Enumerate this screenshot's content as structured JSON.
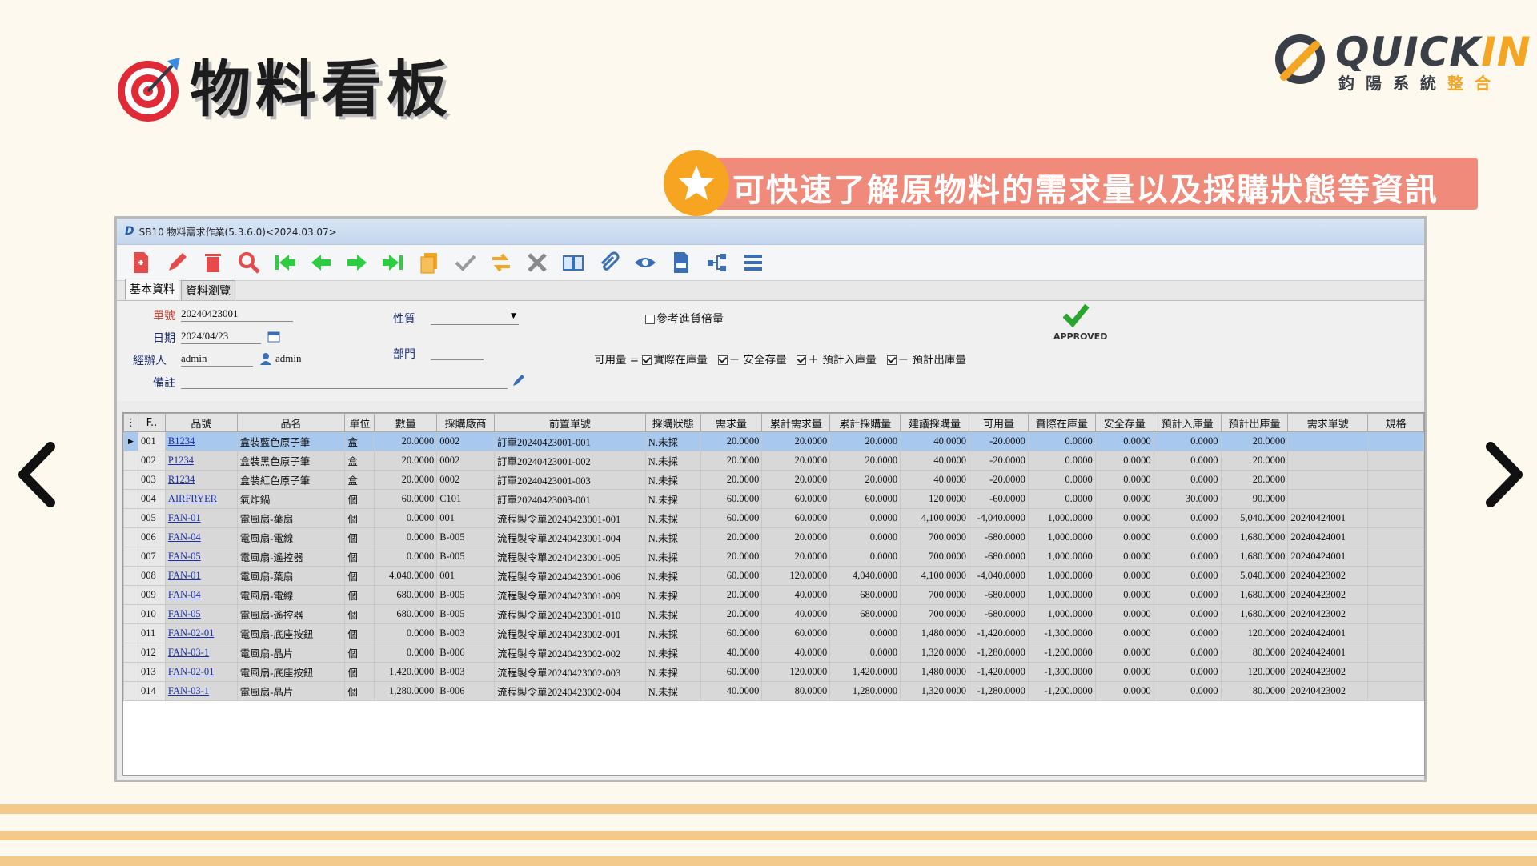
{
  "page": {
    "title": "物料看板",
    "banner": "可快速了解原物料的需求量以及採購狀態等資訊"
  },
  "logo": {
    "name_main": "QUICK",
    "name_accent": "IN",
    "sub_main": "鈞陽系統",
    "sub_accent": "整合"
  },
  "colors": {
    "banner": "#f08a7a",
    "accent": "#f5a524",
    "stripe": "#f3c98c",
    "selected_row": "#a9c8ee"
  },
  "window": {
    "title": "SB10 物料需求作業(5.3.6.0)<2024.03.07>"
  },
  "toolbar": {
    "icons": [
      "new-doc-icon",
      "edit-pencil-icon",
      "delete-trash-icon",
      "search-icon",
      "first-record-icon",
      "prev-record-icon",
      "next-record-icon",
      "last-record-icon",
      "copy-icon",
      "confirm-check-icon",
      "transfer-icon",
      "cancel-x-icon",
      "book-icon",
      "attach-icon",
      "view-eye-icon",
      "print-icon",
      "tree-icon",
      "menu-icon"
    ]
  },
  "tabs": [
    "基本資料",
    "資料瀏覽"
  ],
  "form": {
    "order_no_label": "單號",
    "order_no": "20240423001",
    "date_label": "日期",
    "date": "2024/04/23",
    "handler_label": "經辦人",
    "handler": "admin",
    "handler_name": "admin",
    "note_label": "備註",
    "note": "",
    "nature_label": "性質",
    "nature": "",
    "dept_label": "部門",
    "dept": "",
    "ref_label": "參考進貨倍量",
    "formula_label": "可用量 =",
    "formula_item1": "實際在庫量",
    "formula_item2": "－ 安全存量",
    "formula_item3": "＋ 預計入庫量",
    "formula_item4": "－ 預計出庫量",
    "status": "APPROVED"
  },
  "grid": {
    "columns": [
      "F..",
      "品號",
      "品名",
      "單位",
      "數量",
      "採購廠商",
      "前置單號",
      "採購狀態",
      "需求量",
      "累計需求量",
      "累計採購量",
      "建議採購量",
      "可用量",
      "實際在庫量",
      "安全存量",
      "預計入庫量",
      "預計出庫量",
      "需求單號",
      "規格"
    ],
    "rows": [
      [
        "001",
        "B1234",
        "盒裝藍色原子筆",
        "盒",
        "20.0000",
        "0002",
        "訂單20240423001-001",
        "N.未採",
        "20.0000",
        "20.0000",
        "20.0000",
        "40.0000",
        "-20.0000",
        "0.0000",
        "0.0000",
        "0.0000",
        "20.0000",
        "",
        ""
      ],
      [
        "002",
        "P1234",
        "盒裝黑色原子筆",
        "盒",
        "20.0000",
        "0002",
        "訂單20240423001-002",
        "N.未採",
        "20.0000",
        "20.0000",
        "20.0000",
        "40.0000",
        "-20.0000",
        "0.0000",
        "0.0000",
        "0.0000",
        "20.0000",
        "",
        ""
      ],
      [
        "003",
        "R1234",
        "盒裝紅色原子筆",
        "盒",
        "20.0000",
        "0002",
        "訂單20240423001-003",
        "N.未採",
        "20.0000",
        "20.0000",
        "20.0000",
        "40.0000",
        "-20.0000",
        "0.0000",
        "0.0000",
        "0.0000",
        "20.0000",
        "",
        ""
      ],
      [
        "004",
        "AIRFRYER",
        "氣炸鍋",
        "個",
        "60.0000",
        "C101",
        "訂單20240423003-001",
        "N.未採",
        "60.0000",
        "60.0000",
        "60.0000",
        "120.0000",
        "-60.0000",
        "0.0000",
        "0.0000",
        "30.0000",
        "90.0000",
        "",
        ""
      ],
      [
        "005",
        "FAN-01",
        "電風扇-葉扇",
        "個",
        "0.0000",
        "001",
        "流程製令單20240423001-001",
        "N.未採",
        "60.0000",
        "60.0000",
        "0.0000",
        "4,100.0000",
        "-4,040.0000",
        "1,000.0000",
        "0.0000",
        "0.0000",
        "5,040.0000",
        "20240424001",
        ""
      ],
      [
        "006",
        "FAN-04",
        "電風扇-電線",
        "個",
        "0.0000",
        "B-005",
        "流程製令單20240423001-004",
        "N.未採",
        "20.0000",
        "20.0000",
        "0.0000",
        "700.0000",
        "-680.0000",
        "1,000.0000",
        "0.0000",
        "0.0000",
        "1,680.0000",
        "20240424001",
        ""
      ],
      [
        "007",
        "FAN-05",
        "電風扇-遙控器",
        "個",
        "0.0000",
        "B-005",
        "流程製令單20240423001-005",
        "N.未採",
        "20.0000",
        "20.0000",
        "0.0000",
        "700.0000",
        "-680.0000",
        "1,000.0000",
        "0.0000",
        "0.0000",
        "1,680.0000",
        "20240424001",
        ""
      ],
      [
        "008",
        "FAN-01",
        "電風扇-葉扇",
        "個",
        "4,040.0000",
        "001",
        "流程製令單20240423001-006",
        "N.未採",
        "60.0000",
        "120.0000",
        "4,040.0000",
        "4,100.0000",
        "-4,040.0000",
        "1,000.0000",
        "0.0000",
        "0.0000",
        "5,040.0000",
        "20240423002",
        ""
      ],
      [
        "009",
        "FAN-04",
        "電風扇-電線",
        "個",
        "680.0000",
        "B-005",
        "流程製令單20240423001-009",
        "N.未採",
        "20.0000",
        "40.0000",
        "680.0000",
        "700.0000",
        "-680.0000",
        "1,000.0000",
        "0.0000",
        "0.0000",
        "1,680.0000",
        "20240423002",
        ""
      ],
      [
        "010",
        "FAN-05",
        "電風扇-遙控器",
        "個",
        "680.0000",
        "B-005",
        "流程製令單20240423001-010",
        "N.未採",
        "20.0000",
        "40.0000",
        "680.0000",
        "700.0000",
        "-680.0000",
        "1,000.0000",
        "0.0000",
        "0.0000",
        "1,680.0000",
        "20240423002",
        ""
      ],
      [
        "011",
        "FAN-02-01",
        "電風扇-底座按鈕",
        "個",
        "0.0000",
        "B-003",
        "流程製令單20240423002-001",
        "N.未採",
        "60.0000",
        "60.0000",
        "0.0000",
        "1,480.0000",
        "-1,420.0000",
        "-1,300.0000",
        "0.0000",
        "0.0000",
        "120.0000",
        "20240424001",
        ""
      ],
      [
        "012",
        "FAN-03-1",
        "電風扇-晶片",
        "個",
        "0.0000",
        "B-006",
        "流程製令單20240423002-002",
        "N.未採",
        "40.0000",
        "40.0000",
        "0.0000",
        "1,320.0000",
        "-1,280.0000",
        "-1,200.0000",
        "0.0000",
        "0.0000",
        "80.0000",
        "20240424001",
        ""
      ],
      [
        "013",
        "FAN-02-01",
        "電風扇-底座按鈕",
        "個",
        "1,420.0000",
        "B-003",
        "流程製令單20240423002-003",
        "N.未採",
        "60.0000",
        "120.0000",
        "1,420.0000",
        "1,480.0000",
        "-1,420.0000",
        "-1,300.0000",
        "0.0000",
        "0.0000",
        "120.0000",
        "20240423002",
        ""
      ],
      [
        "014",
        "FAN-03-1",
        "電風扇-晶片",
        "個",
        "1,280.0000",
        "B-006",
        "流程製令單20240423002-004",
        "N.未採",
        "40.0000",
        "80.0000",
        "1,280.0000",
        "1,320.0000",
        "-1,280.0000",
        "-1,200.0000",
        "0.0000",
        "0.0000",
        "80.0000",
        "20240423002",
        ""
      ]
    ]
  }
}
